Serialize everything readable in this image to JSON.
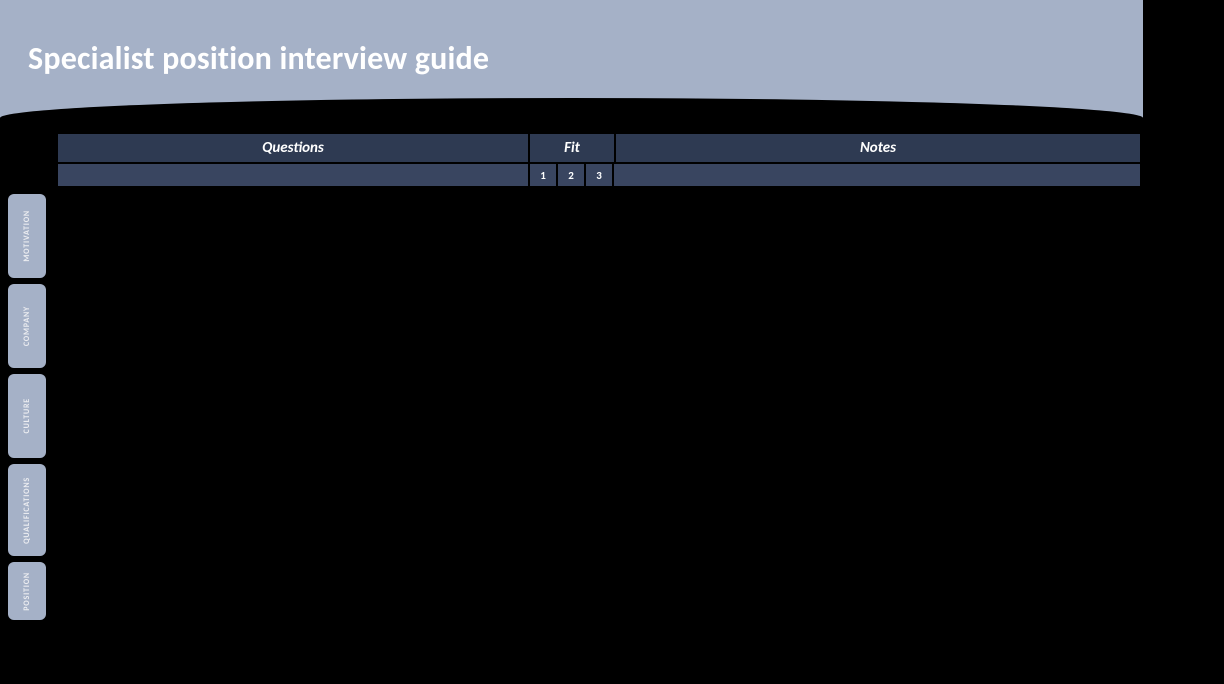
{
  "header": {
    "title": "Specialist position interview guide"
  },
  "sidebar": {
    "tabs": [
      {
        "label": "MOTIVATION"
      },
      {
        "label": "COMPANY"
      },
      {
        "label": "CULTURE"
      },
      {
        "label": "QUALIFICATIONS"
      },
      {
        "label": "POSITION"
      }
    ]
  },
  "table": {
    "columns": {
      "questions": "Questions",
      "fit": "Fit",
      "notes": "Notes"
    },
    "fit_levels": [
      "1",
      "2",
      "3"
    ]
  }
}
